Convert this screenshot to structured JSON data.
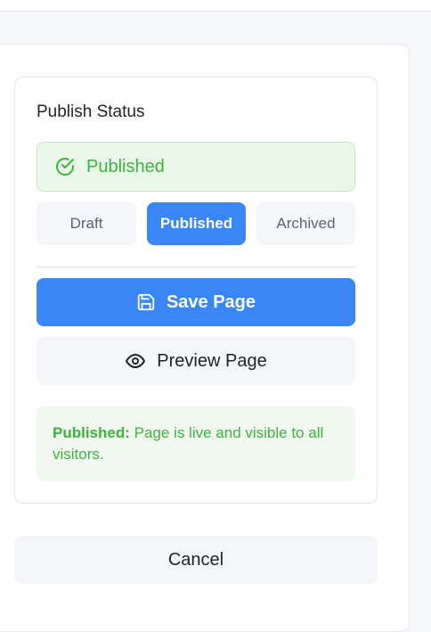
{
  "card": {
    "title": "Publish Status"
  },
  "status_banner": {
    "label": "Published",
    "icon": "check-circle-icon",
    "color": "#3db43d"
  },
  "segments": [
    {
      "label": "Draft",
      "selected": false
    },
    {
      "label": "Published",
      "selected": true
    },
    {
      "label": "Archived",
      "selected": false
    }
  ],
  "buttons": {
    "save": {
      "label": "Save Page",
      "icon": "save-icon",
      "color": "#3b86f7"
    },
    "preview": {
      "label": "Preview Page",
      "icon": "eye-icon"
    },
    "cancel": {
      "label": "Cancel"
    }
  },
  "info": {
    "strong": "Published:",
    "text": " Page is live and visible to all visitors."
  }
}
